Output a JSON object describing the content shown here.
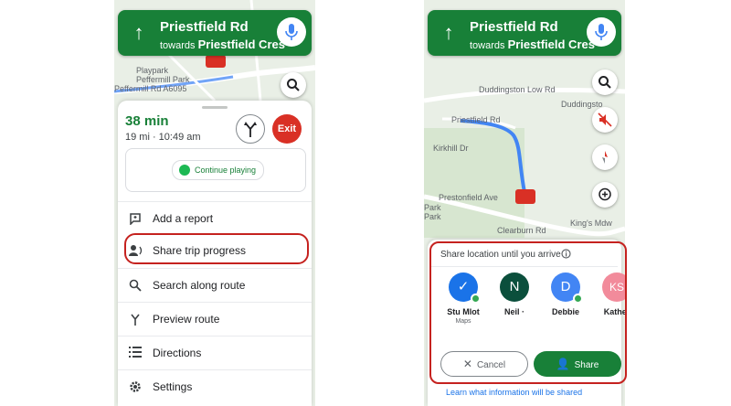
{
  "nav": {
    "road": "Priestfield Rd",
    "towards_prefix": "towards",
    "towards_road": "Priestfield Cres"
  },
  "left_map_labels": [
    "Playpark",
    "Peffermill Park",
    "Peffermill Rd A6095"
  ],
  "right_map_labels": [
    "Duddingston Low Rd",
    "Duddingsto",
    "Priestfield Rd",
    "Kirkhill Dr",
    "Prestonfield Ave",
    "Clearburn Rd",
    "King's Mdw",
    "Park",
    "Park"
  ],
  "trip": {
    "eta": "38 min",
    "details": "19 mi · 10:49 am",
    "exit_label": "Exit",
    "continue_label": "Continue playing"
  },
  "menu": [
    {
      "label": "Add a report",
      "icon": "report-icon"
    },
    {
      "label": "Share trip progress",
      "icon": "share-trip-icon"
    },
    {
      "label": "Search along route",
      "icon": "search-icon"
    },
    {
      "label": "Preview route",
      "icon": "preview-route-icon"
    },
    {
      "label": "Directions",
      "icon": "list-icon"
    },
    {
      "label": "Settings",
      "icon": "gear-icon"
    }
  ],
  "share_panel": {
    "title": "Share location until you arrive",
    "contacts": [
      {
        "name": "Stu Mlot",
        "sub": "Maps",
        "initial": "✓",
        "color": "#1a73e8"
      },
      {
        "name": "Neil ·",
        "sub": "",
        "initial": "N",
        "color": "#0b4f3c"
      },
      {
        "name": "Debbie",
        "sub": "",
        "initial": "D",
        "color": "#4285f4"
      },
      {
        "name": "Kather",
        "sub": "",
        "initial": "KS",
        "color": "#f28b9b"
      }
    ],
    "cancel_label": "Cancel",
    "share_label": "Share",
    "learn_link": "Learn what information will be shared"
  },
  "colors": {
    "nav_green": "#188038",
    "exit_red": "#d93025",
    "highlight_red": "#c5221f",
    "route_blue": "#4285f4"
  }
}
